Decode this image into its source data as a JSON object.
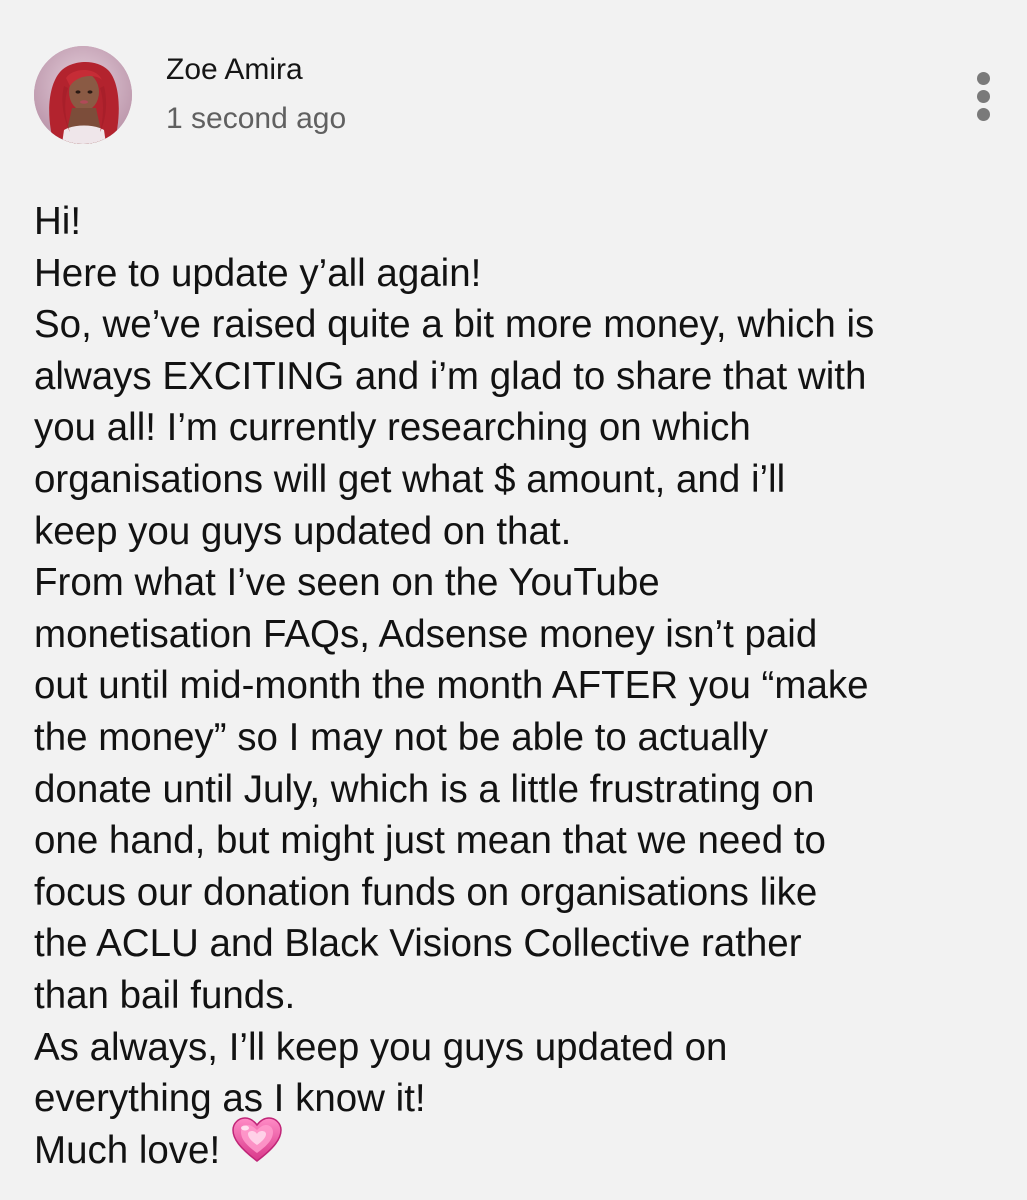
{
  "post": {
    "author": "Zoe Amira",
    "timestamp": "1 second ago",
    "body_lines": [
      "Hi!",
      "Here to update y’all again!",
      "So, we’ve raised quite a bit more money, which is",
      "always EXCITING and i’m glad to share that with",
      "you all! I’m currently researching on which",
      "organisations will get what $ amount, and i’ll",
      "keep you guys updated on that.",
      "From what I’ve seen on the YouTube",
      "monetisation FAQs, Adsense money isn’t paid",
      "out until mid-month the month AFTER you “make",
      "the money” so I may not be able to actually",
      "donate until July, which is a little frustrating on",
      "one hand, but might just mean that we need to",
      "focus our donation funds on organisations like",
      "the ACLU and Black Visions Collective rather",
      "than bail funds.",
      "As always, I’ll keep you guys updated on",
      "everything as I know it!",
      "Much love!"
    ],
    "emoji": "growing-heart-icon"
  },
  "icons": {
    "menu": "more-vertical-icon",
    "avatar": "profile-photo"
  },
  "colors": {
    "background": "#f2f2f2",
    "text": "#121212",
    "secondary_text": "#606060",
    "menu_dots": "#7a7a7a",
    "heart": "#e8509a"
  }
}
